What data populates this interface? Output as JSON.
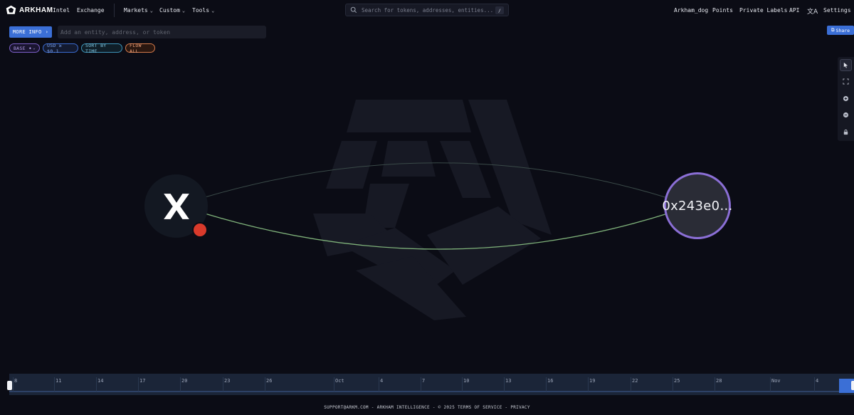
{
  "nav": {
    "brand": "ARKHAM",
    "links": [
      "Intel",
      "Exchange"
    ],
    "dropdowns": [
      "Markets",
      "Custom",
      "Tools"
    ],
    "search_placeholder": "Search for tokens, addresses, entities...",
    "search_shortcut": "/",
    "right_links": [
      "Arkham_dog",
      "Points",
      "Private Labels",
      "API"
    ],
    "translate_icon": "translate-icon",
    "settings": "Settings"
  },
  "controls": {
    "more_info": "MORE INFO",
    "entity_placeholder": "Add an entity, address, or token",
    "share": "Share",
    "chips": {
      "base": "BASE",
      "usd": "USD ≥ $0.1",
      "sort": "SORT BY TIME",
      "flow": "FLOW ALL"
    }
  },
  "graph": {
    "nodes": [
      {
        "type": "entity-logo",
        "icon": "x-logo-icon",
        "badge": "red-dot"
      },
      {
        "type": "address",
        "label": "0x243e0…"
      }
    ],
    "edge_colors": {
      "curve_top": "#3a4a48",
      "curve_bottom": "#7fb27a"
    },
    "node_border_color": "#8b6fd6"
  },
  "timeline": {
    "ticks": [
      "8",
      "11",
      "14",
      "17",
      "20",
      "23",
      "26",
      "Oct",
      "4",
      "7",
      "10",
      "13",
      "16",
      "19",
      "22",
      "25",
      "28",
      "Nov",
      "4"
    ]
  },
  "footer": {
    "text": "SUPPORT@ARKM.COM - ARKHAM INTELLIGENCE - © 2025  TERMS OF SERVICE - PRIVACY"
  },
  "colors": {
    "background": "#0b0c15",
    "accent": "#3b6fd6",
    "red": "#d93a2b",
    "purple": "#8b6fd6"
  }
}
